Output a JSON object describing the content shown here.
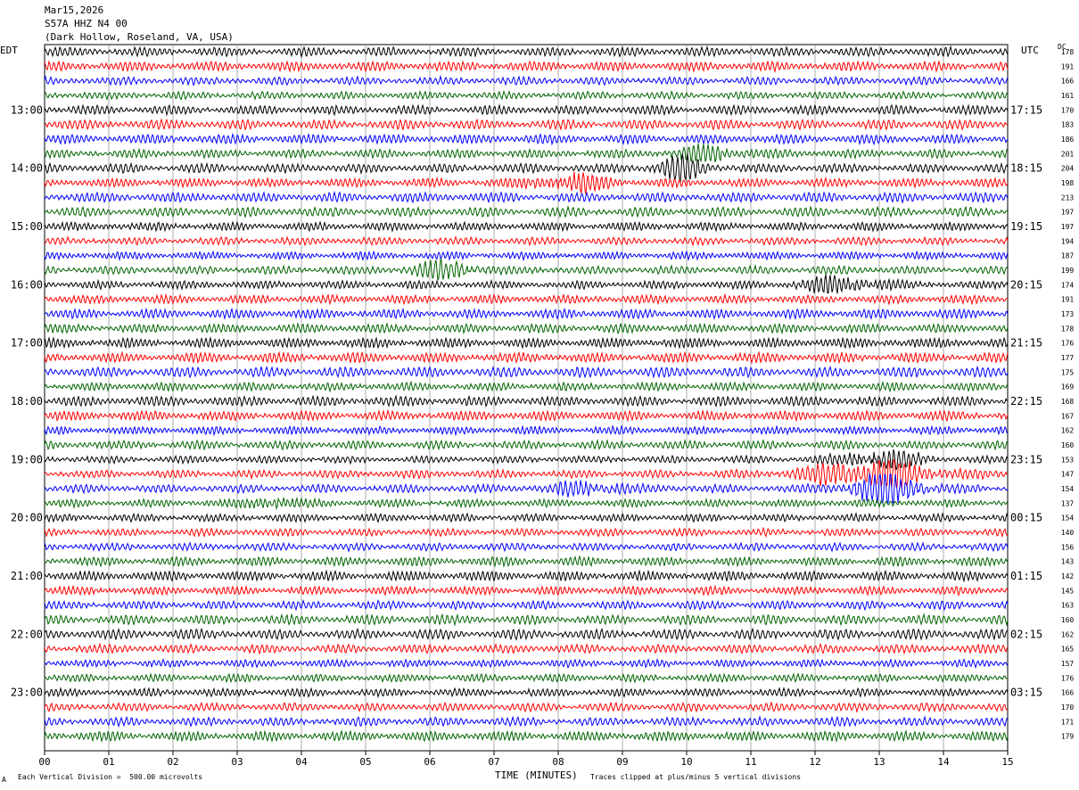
{
  "header": {
    "date": "Mar15,2026",
    "station": "S57A HHZ N4 00",
    "location": "(Dark Hollow, Roseland, VA, USA)"
  },
  "left_tz": "EDT",
  "right_tz": "UTC",
  "dc_label": "DC",
  "footer": {
    "scale": "Each Vertical Division =  500.00 microvolts",
    "clip": "Traces clipped at plus/minus 5 vertical divisions",
    "corner": "A"
  },
  "chart_data": {
    "type": "line",
    "title": "Mar15,2026 S57A HHZ N4 00 (Dark Hollow, Roseland, VA, USA)",
    "xlabel": "TIME (MINUTES)",
    "xlim": [
      0,
      15
    ],
    "x_ticks": [
      "00",
      "01",
      "02",
      "03",
      "04",
      "05",
      "06",
      "07",
      "08",
      "09",
      "10",
      "11",
      "12",
      "13",
      "14",
      "15"
    ],
    "trace_count": 48,
    "traces_per_hour": 4,
    "trace_colors": [
      "#000000",
      "#ff0000",
      "#0000ff",
      "#006400"
    ],
    "left_hour_labels": [
      "13:00",
      "14:00",
      "15:00",
      "16:00",
      "17:00",
      "18:00",
      "19:00",
      "20:00",
      "21:00",
      "22:00",
      "23:00"
    ],
    "right_hour_labels": [
      "17:15",
      "18:15",
      "19:15",
      "20:15",
      "21:15",
      "22:15",
      "23:15",
      "00:15",
      "01:15",
      "02:15",
      "03:15"
    ],
    "dc_offsets": [
      178,
      191,
      166,
      161,
      170,
      183,
      186,
      201,
      204,
      198,
      213,
      197,
      197,
      194,
      187,
      199,
      174,
      191,
      173,
      178,
      176,
      177,
      175,
      169,
      168,
      167,
      162,
      160,
      153,
      147,
      154,
      137,
      154,
      140,
      156,
      143,
      142,
      145,
      163,
      160,
      162,
      165,
      157,
      176,
      166,
      170,
      171,
      179
    ]
  }
}
